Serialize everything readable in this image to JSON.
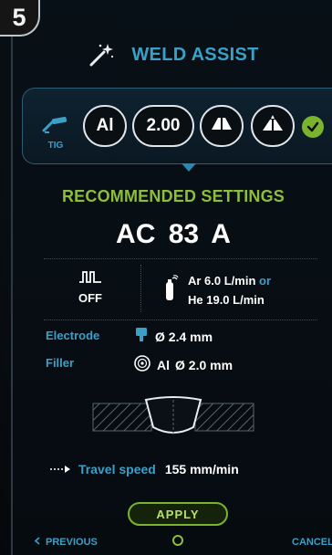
{
  "step": "5",
  "header": {
    "title": "WELD ASSIST",
    "icon": "magic-wand-icon"
  },
  "process": {
    "label": "TIG",
    "icon": "tig-torch-icon"
  },
  "selections": {
    "material": "Al",
    "diameter": "2.00",
    "joint_1_icon": "butt-joint-icon",
    "joint_2_icon": "groove-joint-icon",
    "status_icon": "check-icon"
  },
  "recommended": {
    "title": "RECOMMENDED SETTINGS",
    "current": "AC 83 A",
    "pulse_icon": "pulse-wave-icon",
    "pulse_value": "OFF",
    "gas_icon": "gas-bottle-icon",
    "gas_ar": "Ar 6.0 L/min",
    "gas_or": "or",
    "gas_he": "He 19.0 L/min",
    "electrode_label": "Electrode",
    "electrode_value": "Ø 2.4 mm",
    "filler_label": "Filler",
    "filler_material": "Al",
    "filler_value": "Ø 2.0 mm",
    "travel_label": "Travel speed",
    "travel_value": "155 mm/min"
  },
  "actions": {
    "apply": "APPLY",
    "previous": "PREVIOUS",
    "cancel": "CANCEL"
  },
  "colors": {
    "accent": "#3aa0c8",
    "green": "#8dbd3c",
    "background": "#060b10"
  }
}
